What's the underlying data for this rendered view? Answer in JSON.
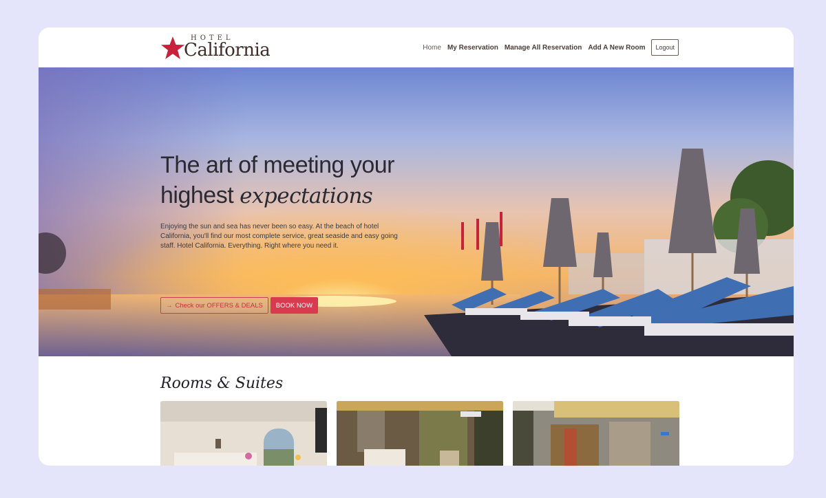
{
  "brand": {
    "top": "HOTEL",
    "name": "California",
    "colors": {
      "star": "#c8213a",
      "text": "#3d2c28"
    }
  },
  "nav": {
    "home": "Home",
    "my_reservation": "My Reservation",
    "manage_all": "Manage All Reservation",
    "add_room": "Add A New Room",
    "logout": "Logout"
  },
  "hero": {
    "headline_line1": "The art of meeting your",
    "headline_line2_plain": "highest ",
    "headline_line2_emph": "expectations",
    "description": "Enjoying the sun and sea has never been so easy. At the beach of hotel California, you'll find our most complete service, great seaside and easy going staff. Hotel California. Everything. Right where you need it.",
    "offers_button": "Check our OFFERS & DEALS",
    "offers_icon": "arrow-right-icon",
    "book_button": "BOOK NOW",
    "colors": {
      "accent": "#d83a4e"
    }
  },
  "rooms": {
    "title": "Rooms & Suites",
    "cards": [
      {
        "name": "room-photo-1"
      },
      {
        "name": "room-photo-2"
      },
      {
        "name": "room-photo-3"
      }
    ]
  }
}
